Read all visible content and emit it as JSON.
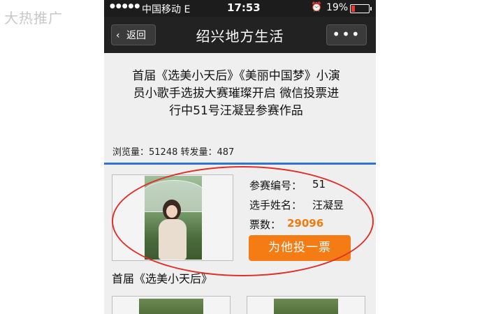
{
  "watermark": "大热推广",
  "status_bar": {
    "signal": "●●●●●",
    "carrier": "中国移动 E",
    "time": "17:53",
    "battery_percent": "19%"
  },
  "nav": {
    "back_label": "返回",
    "title": "绍兴地方生活",
    "more_label": "•••"
  },
  "article": {
    "title": "首届《选美小天后》《美丽中国梦》小演员小歌手选拔大赛璀璨开启 微信投票进行中51号汪凝昱参赛作品",
    "stats": "浏览量：51248 转发量：487"
  },
  "entry": {
    "number_label": "参赛编号：",
    "number_value": "51",
    "name_label": "选手姓名：",
    "name_value": "汪凝昱",
    "votes_label": "票数：",
    "votes_value": "29096",
    "vote_button": "为他投一票"
  },
  "section_title": "首届《选美小天后》",
  "colors": {
    "accent_blue": "#2f74cf",
    "vote_orange": "#f57c14",
    "highlight_red": "#e0302a"
  }
}
